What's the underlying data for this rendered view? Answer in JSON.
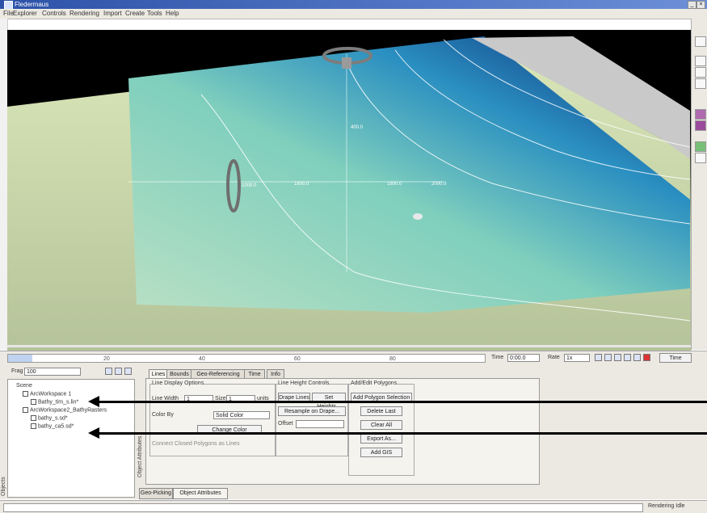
{
  "window": {
    "title": "Fledermaus"
  },
  "menu": [
    "File",
    "Explorer",
    "Controls",
    "Rendering",
    "Import",
    "Create",
    "Tools",
    "Help"
  ],
  "scene": {
    "contour_labels": [
      "400.0",
      "1000.0",
      "1600.0",
      "1800.0",
      "2000.0"
    ]
  },
  "timebar": {
    "ticks": [
      "0",
      "20",
      "40",
      "60",
      "80"
    ],
    "time_label": "Time",
    "time_value": "0:00.0",
    "rate_label": "Rate",
    "rate_value": "1x",
    "time_button": "Time"
  },
  "tree": {
    "frag_label": "Frag",
    "frag_value": "100",
    "nodes": [
      {
        "label": "Scene"
      },
      {
        "label": "ArcWorkspace 1"
      },
      {
        "label": "Bathy_tim_s.lin*"
      },
      {
        "label": "ArcWorkspace2_BathyRasters"
      },
      {
        "label": "bathy_s.sd*"
      },
      {
        "label": "bathy_ca5.sd*"
      }
    ],
    "side_label": "Objects"
  },
  "attributes": {
    "tabs": [
      "Lines",
      "Bounds",
      "Geo-Referencing",
      "Time",
      "Info"
    ],
    "side_label": "Object Attributes",
    "line_display_options": "Line Display Options",
    "line_width_label": "Line Width",
    "line_width_value": "1",
    "size_label": "Size",
    "size_value": "1",
    "units_label": "units",
    "color_by_label": "Color By",
    "color_by_value": "Solid Color",
    "change_color": "Change Color",
    "checkbox_label": "Connect Closed Polygons as Lines",
    "line_height_controls": "Line Height Controls",
    "drape_lines": "Drape Lines",
    "set_heights": "Set Heights...",
    "resample_on_drape": "Resample on Drape...",
    "offset_label": "Offset",
    "add_edit_polygons": "Add/Edit Polygons",
    "add_polygon_selection": "Add Polygon Selection",
    "delete_last": "Delete Last",
    "clear_all": "Clear All",
    "export_as": "Export As...",
    "add_gis": "Add GIS"
  },
  "bottom_tabs": [
    "Geo-Picking",
    "Object Attributes"
  ],
  "status": {
    "text": "Rendering Idle"
  },
  "colors": {
    "deep": "#0a1e6e",
    "mid": "#1f7fb8",
    "shallow": "#a8e0c8",
    "sand": "#c7d3ab"
  }
}
